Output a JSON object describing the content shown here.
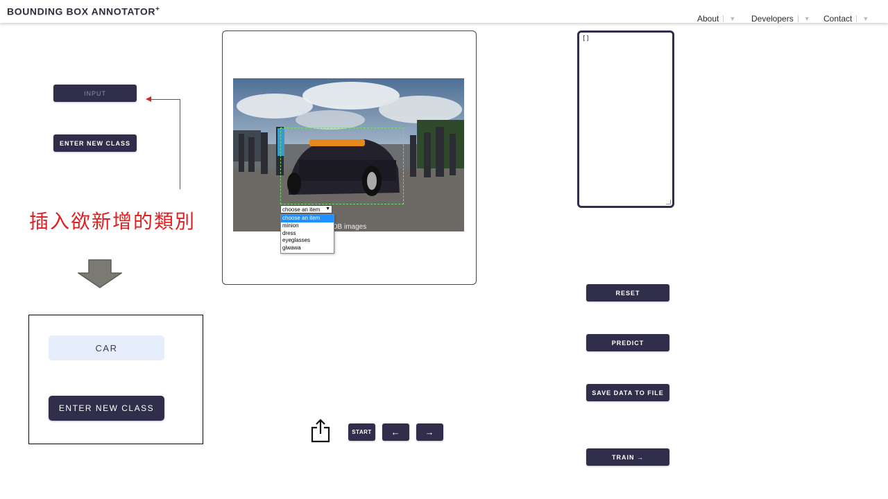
{
  "header": {
    "logo": "BOUNDING BOX ANNOTATOR",
    "logo_mark": "+",
    "nav": [
      "About",
      "Developers",
      "Contact"
    ]
  },
  "left": {
    "input_button": "INPUT",
    "enter_class_button": "ENTER NEW CLASS",
    "annotation_text": "插入欲新增的類別",
    "inset_value": "CAR",
    "inset_button": "ENTER NEW CLASS"
  },
  "image": {
    "photo_caption": "...DB images",
    "class_select": {
      "selected": "choose an item",
      "options": [
        "choose an item",
        "minion",
        "dress",
        "eyeglasses",
        "giwawa"
      ]
    }
  },
  "output": {
    "json_text": "[]"
  },
  "controls": {
    "start": "START",
    "prev": "←",
    "next": "→",
    "reset": "RESET",
    "predict": "PREDICT",
    "save": "SAVE DATA TO FILE",
    "train": "TRAIN →"
  },
  "colors": {
    "button_bg": "#302e4a",
    "annotation_red": "#e02020",
    "bbox_green": "#6ee06a",
    "highlight": "#1e90ff"
  }
}
